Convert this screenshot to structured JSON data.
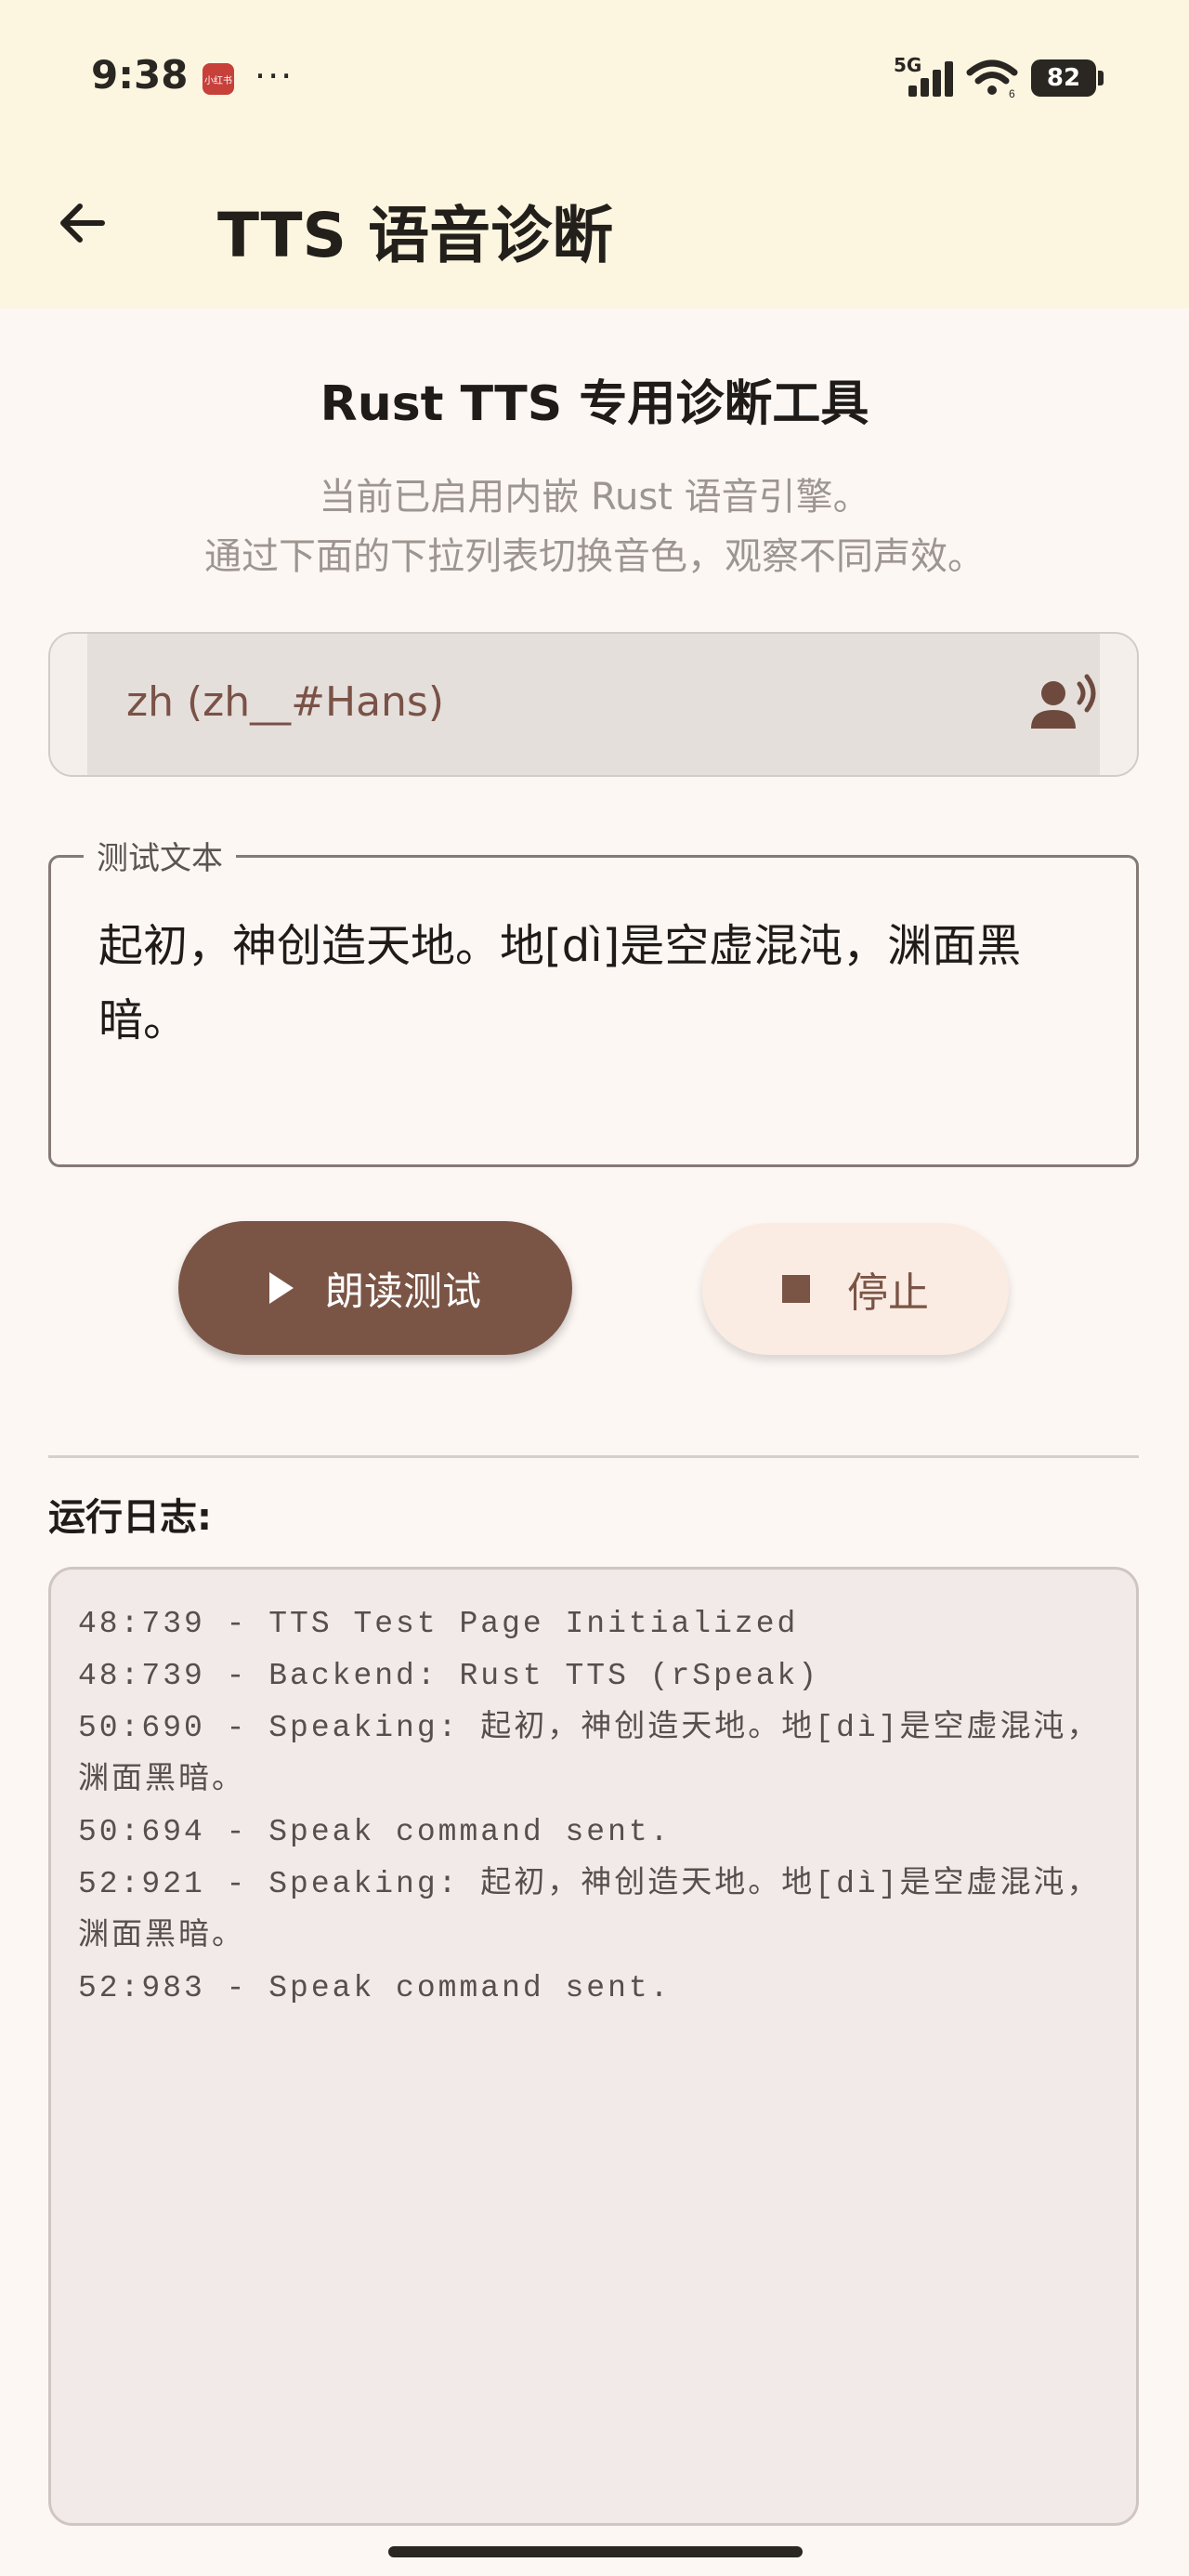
{
  "status_bar": {
    "time": "9:38",
    "app_badge": "小红书",
    "dots": "···",
    "network": "5G",
    "wifi_sub": "6",
    "battery": "82"
  },
  "header": {
    "title": "TTS 语音诊断",
    "back_icon": "arrow-back-icon"
  },
  "main": {
    "heading": "Rust TTS 专用诊断工具",
    "subtitle_line1": "当前已启用内嵌 Rust 语音引擎。",
    "subtitle_line2": "通过下面的下拉列表切换音色，观察不同声效。",
    "voice_select": {
      "value": "zh (zh__#Hans)",
      "icon": "record-voice-icon"
    },
    "test_text": {
      "label": "测试文本",
      "value": "起初，神创造天地。地[dì]是空虚混沌，渊面黑暗。"
    },
    "buttons": {
      "play_label": "朗读测试",
      "stop_label": "停止"
    },
    "log": {
      "label": "运行日志:",
      "entries": [
        "48:739 - TTS Test Page Initialized",
        "48:739 - Backend: Rust TTS (rSpeak)",
        "50:690 - Speaking: 起初，神创造天地。地[dì]是空虚混沌，渊面黑暗。",
        "50:694 - Speak command sent.",
        "52:921 - Speaking: 起初，神创造天地。地[dì]是空虚混沌，渊面黑暗。",
        "52:983 - Speak command sent."
      ]
    }
  }
}
